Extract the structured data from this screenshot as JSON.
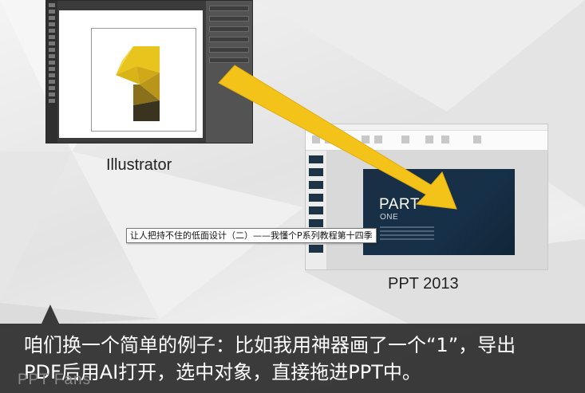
{
  "illustrator": {
    "label": "Illustrator"
  },
  "powerpoint": {
    "label": "PPT 2013",
    "slide_title": "PART",
    "slide_subtitle": "ONE"
  },
  "tooltip": {
    "text": "让人把持不住的低面设计（二）——我懂个P系列教程第十四季"
  },
  "caption": {
    "line1": "咱们换一个简单的例子：比如我用神器画了一个“1”，导出",
    "line2": "PDF后用AI打开，选中对象，直接拖进PPT中。"
  },
  "watermark": {
    "text": "PPT Fans"
  },
  "colors": {
    "arrow": "#f4c31a",
    "caption_bg": "#2d2d2d",
    "slide_bg": "#173049"
  }
}
